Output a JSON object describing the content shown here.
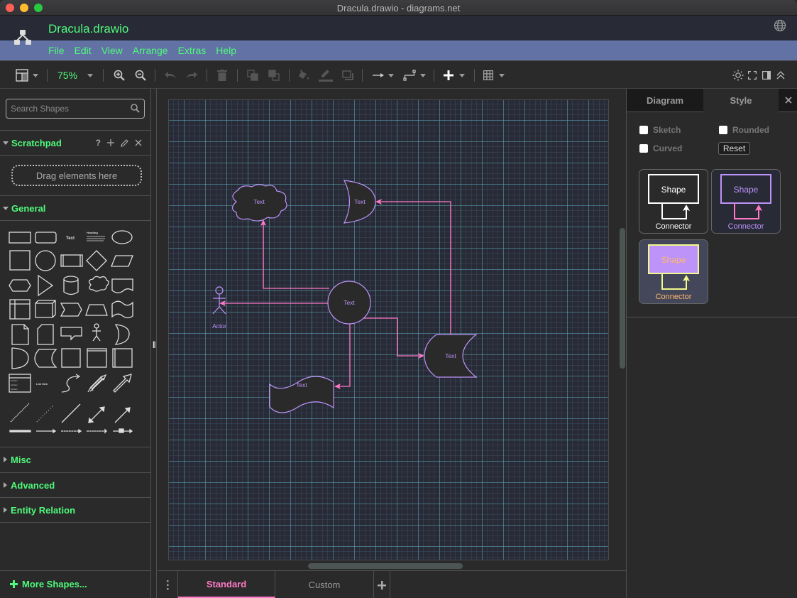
{
  "window": {
    "title": "Dracula.drawio - diagrams.net"
  },
  "header": {
    "filename": "Dracula.drawio",
    "menu": [
      "File",
      "Edit",
      "View",
      "Arrange",
      "Extras",
      "Help"
    ],
    "language_icon": "globe-icon"
  },
  "toolbar": {
    "zoom": "75%",
    "icons": [
      "format-panel-icon",
      "zoom-in-icon",
      "zoom-out-icon",
      "undo-icon",
      "redo-icon",
      "delete-icon",
      "to-front-icon",
      "to-back-icon",
      "fill-color-icon",
      "line-color-icon",
      "shadow-icon",
      "connection-icon",
      "waypoints-icon",
      "insert-icon",
      "table-icon",
      "theme-icon",
      "fullscreen-icon",
      "toggle-panel-icon",
      "collapse-icon"
    ]
  },
  "sidebar": {
    "search_placeholder": "Search Shapes",
    "scratchpad": {
      "label": "Scratchpad",
      "help": "?",
      "dropzone": "Drag elements here"
    },
    "sections": [
      {
        "label": "General",
        "expanded": true
      },
      {
        "label": "Misc",
        "expanded": false
      },
      {
        "label": "Advanced",
        "expanded": false
      },
      {
        "label": "Entity Relation",
        "expanded": false
      }
    ],
    "general_shape_labels": {
      "text": "Text",
      "heading": "Heading",
      "list": "List",
      "list_item": "List Item"
    },
    "more_shapes": "More Shapes..."
  },
  "diagram": {
    "colors": {
      "background": "#282a36",
      "grid_minor": "#3c4c5e",
      "grid_major": "#5fb4c4",
      "shape_fill": "#2a2a2a",
      "shape_stroke": "#bd93f9",
      "edge": "#ff79c6",
      "label": "#bd93f9"
    },
    "nodes": [
      {
        "id": "cloud",
        "label": "Text"
      },
      {
        "id": "moon",
        "label": "Text"
      },
      {
        "id": "circle",
        "label": "Text"
      },
      {
        "id": "actor",
        "label": "Actor"
      },
      {
        "id": "stored-data",
        "label": "Text"
      },
      {
        "id": "tape",
        "label": "Text"
      }
    ]
  },
  "pages": {
    "tabs": [
      {
        "label": "Standard",
        "active": true
      },
      {
        "label": "Custom",
        "active": false
      }
    ]
  },
  "format_panel": {
    "tabs": [
      "Diagram",
      "Style"
    ],
    "active_tab": "Style",
    "options": {
      "sketch": {
        "label": "Sketch",
        "checked": false
      },
      "rounded": {
        "label": "Rounded",
        "checked": false
      },
      "curved": {
        "label": "Curved",
        "checked": false
      }
    },
    "reset": "Reset",
    "styles": [
      {
        "shape_label": "Shape",
        "connector_label": "Connector",
        "bg": "#2a2a2a",
        "stroke": "#ffffff",
        "fill": "#2a2a2a",
        "text": "#ffffff",
        "edge": "#ffffff",
        "edge_text": "#ffffff"
      },
      {
        "shape_label": "Shape",
        "connector_label": "Connector",
        "bg": "#282a36",
        "stroke": "#bd93f9",
        "fill": "#282a36",
        "text": "#bd93f9",
        "edge": "#ff79c6",
        "edge_text": "#bd93f9"
      },
      {
        "shape_label": "Shape",
        "connector_label": "Connector",
        "bg": "#44475a",
        "stroke": "#f1fa8c",
        "fill": "#bd93f9",
        "text": "#ffb86c",
        "edge": "#f1fa8c",
        "edge_text": "#ffb86c"
      }
    ]
  }
}
